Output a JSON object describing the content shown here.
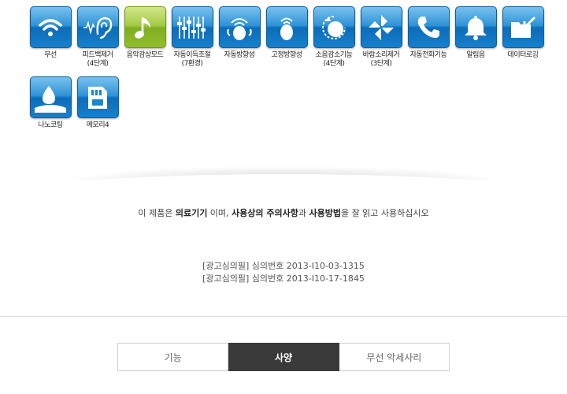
{
  "features": [
    {
      "icon": "wifi-icon",
      "label": "무선"
    },
    {
      "icon": "ear-feedback-icon",
      "label": "피드백제거\n(4단계)"
    },
    {
      "icon": "music-note-icon",
      "label": "음악감상모드"
    },
    {
      "icon": "sliders-icon",
      "label": "자동이득조절\n(7환경)"
    },
    {
      "icon": "directional-mic-icon",
      "label": "자동방향성"
    },
    {
      "icon": "fixed-direction-icon",
      "label": "고정방향성"
    },
    {
      "icon": "noise-reduction-icon",
      "label": "소음감소기능\n(4단계)"
    },
    {
      "icon": "pinwheel-wind-icon",
      "label": "바람소리제거\n(3단계)"
    },
    {
      "icon": "phone-icon",
      "label": "자동전화기능"
    },
    {
      "icon": "bell-icon",
      "label": "알림음"
    },
    {
      "icon": "data-logging-icon",
      "label": "데이터로깅"
    },
    {
      "icon": "water-drop-icon",
      "label": "나노코팅"
    },
    {
      "icon": "memory-card-icon",
      "label": "메모리4"
    }
  ],
  "notice": {
    "prefix": "이 제품은 ",
    "medical": "의료기기",
    "mid1": " 이며, ",
    "caution": "사용상의 주의사항",
    "mid2": "과 ",
    "usage": "사용방법",
    "suffix": "을 잘 읽고 사용하십시오"
  },
  "review": [
    "[광고심의필] 심의번호 2013-I10-03-1315",
    "[광고심의필] 심의번호 2013-I10-17-1845"
  ],
  "tabs": [
    {
      "label": "기능",
      "active": false
    },
    {
      "label": "사양",
      "active": true
    },
    {
      "label": "무선 악세사리",
      "active": false
    }
  ],
  "colors": {
    "tile": "#1a86d0",
    "tile_music": "#98c232",
    "tab_active": "#3a3a3a"
  }
}
